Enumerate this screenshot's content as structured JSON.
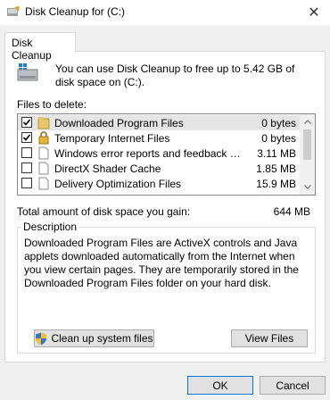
{
  "window": {
    "title": "Disk Cleanup for  (C:)",
    "close_icon": "close-icon"
  },
  "tab": {
    "label": "Disk Cleanup"
  },
  "info": {
    "text": "You can use Disk Cleanup to free up to 5.42 GB of disk space on  (C:)."
  },
  "files": {
    "label": "Files to delete:",
    "items": [
      {
        "name": "Downloaded Program Files",
        "size": "0 bytes",
        "checked": true
      },
      {
        "name": "Temporary Internet Files",
        "size": "0 bytes",
        "checked": true
      },
      {
        "name": "Windows error reports and feedback di...",
        "size": "3.11 MB",
        "checked": false
      },
      {
        "name": "DirectX Shader Cache",
        "size": "1.85 MB",
        "checked": false
      },
      {
        "name": "Delivery Optimization Files",
        "size": "15.9 MB",
        "checked": false
      }
    ]
  },
  "total": {
    "label": "Total amount of disk space you gain:",
    "value": "644 MB"
  },
  "description": {
    "title": "Description",
    "text": "Downloaded Program Files are ActiveX controls and Java applets downloaded automatically from the Internet when you view certain pages. They are temporarily stored in the Downloaded Program Files folder on your hard disk."
  },
  "buttons": {
    "clean_system": "Clean up system files",
    "view_files": "View Files",
    "ok": "OK",
    "cancel": "Cancel"
  }
}
